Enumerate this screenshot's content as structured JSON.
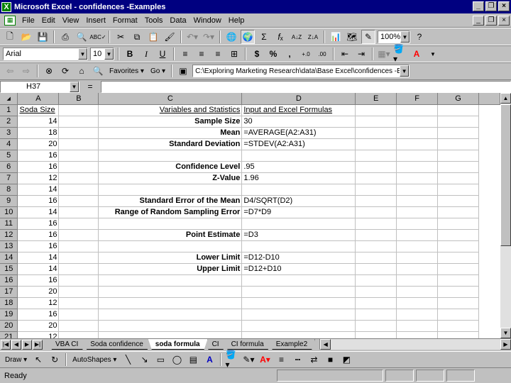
{
  "window": {
    "title": "Microsoft Excel - confidences -Examples",
    "minimize_glyph": "_",
    "restore_glyph": "❐",
    "close_glyph": "×",
    "app_icon": "X"
  },
  "menu": [
    "File",
    "Edit",
    "View",
    "Insert",
    "Format",
    "Tools",
    "Data",
    "Window",
    "Help"
  ],
  "toolbar_standard": {
    "zoom": "100%",
    "icons": [
      "new-icon",
      "open-icon",
      "save-icon",
      "print-icon",
      "print-preview-icon",
      "spelling-icon",
      "cut-icon",
      "copy-icon",
      "paste-icon",
      "format-painter-icon",
      "undo-icon",
      "redo-icon",
      "hyperlink-icon",
      "web-toolbar-icon",
      "autosum-icon",
      "function-icon",
      "sort-ascending-icon",
      "sort-descending-icon",
      "chart-wizard-icon",
      "map-icon",
      "drawing-icon",
      "help-icon"
    ]
  },
  "toolbar_formatting": {
    "font": "Arial",
    "size": "10",
    "bold": "B",
    "italic": "I",
    "underline": "U",
    "currency": "$",
    "percent": "%",
    "comma": ",",
    "inc_decimal": "+.0",
    "dec_decimal": ".00",
    "font_color_letter": "A",
    "accent_red": "#ff0000",
    "highlight_yellow": "#ffff00"
  },
  "toolbar_web": {
    "favorites": "Favorites",
    "go": "Go",
    "address": "C:\\Exploring Marketing Research\\data\\Base Excel\\confidences -Examples"
  },
  "formula_bar": {
    "name_box": "H37",
    "equals": "="
  },
  "columns": [
    "A",
    "B",
    "C",
    "D",
    "E",
    "F",
    "G"
  ],
  "rows": [
    {
      "n": "1",
      "a": "Soda Size",
      "c": "Variables and Statistics",
      "d": "Input and Excel Formulas"
    },
    {
      "n": "2",
      "a": "14",
      "c": "Sample Size",
      "d": "30"
    },
    {
      "n": "3",
      "a": "18",
      "c": "Mean",
      "d": "=AVERAGE(A2:A31)"
    },
    {
      "n": "4",
      "a": "20",
      "c": "Standard Deviation",
      "d": "=STDEV(A2:A31)"
    },
    {
      "n": "5",
      "a": "16",
      "c": "",
      "d": ""
    },
    {
      "n": "6",
      "a": "16",
      "c": "Confidence Level",
      "d": ".95"
    },
    {
      "n": "7",
      "a": "12",
      "c": "Z-Value",
      "d": "1.96"
    },
    {
      "n": "8",
      "a": "14",
      "c": "",
      "d": ""
    },
    {
      "n": "9",
      "a": "16",
      "c": "Standard Error of the Mean",
      "d": "D4/SQRT(D2)"
    },
    {
      "n": "10",
      "a": "14",
      "c": "Range of Random Sampling Error",
      "d": "=D7*D9"
    },
    {
      "n": "11",
      "a": "16",
      "c": "",
      "d": ""
    },
    {
      "n": "12",
      "a": "16",
      "c": "Point Estimate",
      "d": "=D3"
    },
    {
      "n": "13",
      "a": "16",
      "c": "",
      "d": ""
    },
    {
      "n": "14",
      "a": "14",
      "c": "Lower Limit",
      "d": "=D12-D10"
    },
    {
      "n": "15",
      "a": "14",
      "c": "Upper Limit",
      "d": "=D12+D10"
    },
    {
      "n": "16",
      "a": "16",
      "c": "",
      "d": ""
    },
    {
      "n": "17",
      "a": "20",
      "c": "",
      "d": ""
    },
    {
      "n": "18",
      "a": "12",
      "c": "",
      "d": ""
    },
    {
      "n": "19",
      "a": "16",
      "c": "",
      "d": ""
    },
    {
      "n": "20",
      "a": "20",
      "c": "",
      "d": ""
    },
    {
      "n": "21",
      "a": "12",
      "c": "",
      "d": ""
    }
  ],
  "sheet_tabs": [
    "VBA CI",
    "Soda confidence",
    "soda formula",
    "CI",
    "CI formula",
    "Example2"
  ],
  "active_tab": "soda formula",
  "drawing_toolbar": {
    "draw": "Draw",
    "autoshapes": "AutoShapes"
  },
  "status": {
    "text": "Ready"
  }
}
